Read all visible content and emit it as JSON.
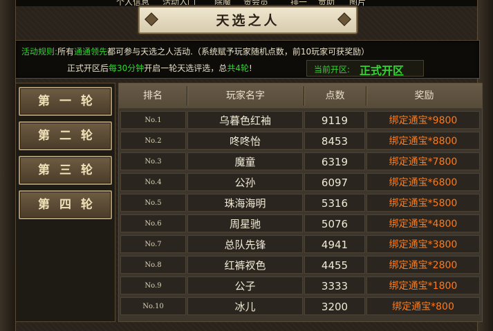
{
  "top_strip": [
    "个人信息",
    "活动入门",
    "除魔",
    "贵会员",
    "排一",
    "贡助",
    "图片"
  ],
  "window": {
    "title": "天选之人"
  },
  "rules": {
    "label": "活动规则:",
    "text_a": "所有",
    "highlight_a": "通通领先",
    "text_b": "都可参与天选之人活动.（系统赋予玩家随机点数，前10玩家可获奖励）",
    "line2_a": "正式开区后",
    "line2_hl_a": "每30分钟",
    "line2_b": "开启一轮天选评选，总",
    "line2_hl_b": "共4轮",
    "line2_c": "!"
  },
  "current_zone": {
    "label": "当前开区:",
    "value": "正式开区"
  },
  "rounds": [
    "第一轮",
    "第二轮",
    "第三轮",
    "第四轮"
  ],
  "table": {
    "headers": [
      "排名",
      "玩家名字",
      "点数",
      "奖励"
    ],
    "rows": [
      {
        "rank": "No.1",
        "name": "乌暮色红袖",
        "points": "9119",
        "reward": "绑定通宝*9800"
      },
      {
        "rank": "No.2",
        "name": "咚咚怡",
        "points": "8453",
        "reward": "绑定通宝*8800"
      },
      {
        "rank": "No.3",
        "name": "魔童",
        "points": "6319",
        "reward": "绑定通宝*7800"
      },
      {
        "rank": "No.4",
        "name": "公孙",
        "points": "6097",
        "reward": "绑定通宝*6800"
      },
      {
        "rank": "No.5",
        "name": "珠海海明",
        "points": "5316",
        "reward": "绑定通宝*5800"
      },
      {
        "rank": "No.6",
        "name": "周星驰",
        "points": "5076",
        "reward": "绑定通宝*4800"
      },
      {
        "rank": "No.7",
        "name": "总队先锋",
        "points": "4941",
        "reward": "绑定通宝*3800"
      },
      {
        "rank": "No.8",
        "name": "红裤衩色",
        "points": "4455",
        "reward": "绑定通宝*2800"
      },
      {
        "rank": "No.9",
        "name": "公子",
        "points": "3333",
        "reward": "绑定通宝*1800"
      },
      {
        "rank": "No.10",
        "name": "冰儿",
        "points": "3200",
        "reward": "绑定通宝*800"
      }
    ]
  }
}
